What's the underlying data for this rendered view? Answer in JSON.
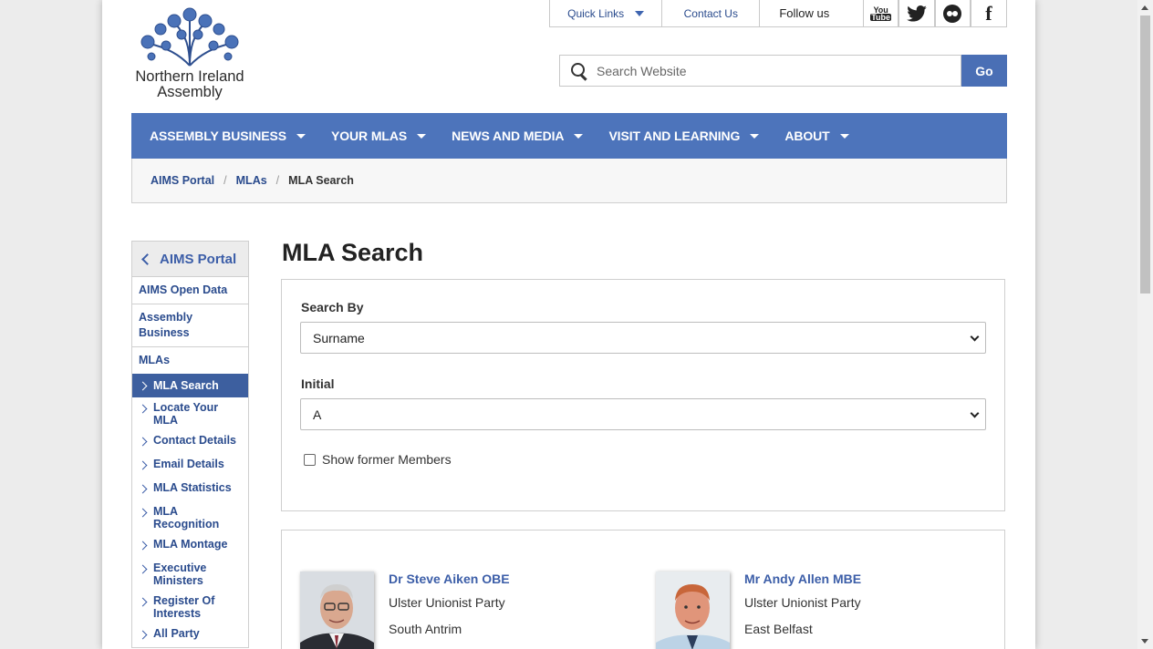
{
  "logo": {
    "line1": "Northern Ireland",
    "line2": "Assembly"
  },
  "util": {
    "quick_links": "Quick Links",
    "contact_us": "Contact Us",
    "follow_us": "Follow us",
    "youtube_top": "You",
    "youtube_bottom": "Tube",
    "facebook": "f"
  },
  "search": {
    "placeholder": "Search Website",
    "go_label": "Go"
  },
  "nav": {
    "items": [
      "ASSEMBLY BUSINESS",
      "YOUR MLAS",
      "NEWS AND MEDIA",
      "VISIT AND LEARNING",
      "ABOUT"
    ]
  },
  "breadcrumb": {
    "items": [
      "AIMS Portal",
      "MLAs"
    ],
    "current": "MLA Search"
  },
  "sidebar": {
    "heading": "AIMS Portal",
    "links": [
      "AIMS Open Data",
      "Assembly Business",
      "MLAs"
    ],
    "sub": [
      "MLA Search",
      "Locate Your MLA",
      "Contact Details",
      "Email Details",
      "MLA Statistics",
      "MLA Recognition",
      "MLA Montage",
      "Executive Ministers",
      "Register Of Interests",
      "All Party"
    ]
  },
  "main": {
    "title": "MLA Search",
    "search_by_label": "Search By",
    "search_by_value": "Surname",
    "initial_label": "Initial",
    "initial_value": "A",
    "show_former_label": "Show former Members"
  },
  "results": [
    {
      "name": "Dr Steve Aiken OBE",
      "party": "Ulster Unionist Party",
      "constituency": "South Antrim"
    },
    {
      "name": "Mr Andy Allen MBE",
      "party": "Ulster Unionist Party",
      "constituency": "East Belfast"
    }
  ],
  "colors": {
    "brand_blue": "#4d74bb",
    "link_blue": "#2a4b8d",
    "active_side": "#3d5f9f"
  }
}
